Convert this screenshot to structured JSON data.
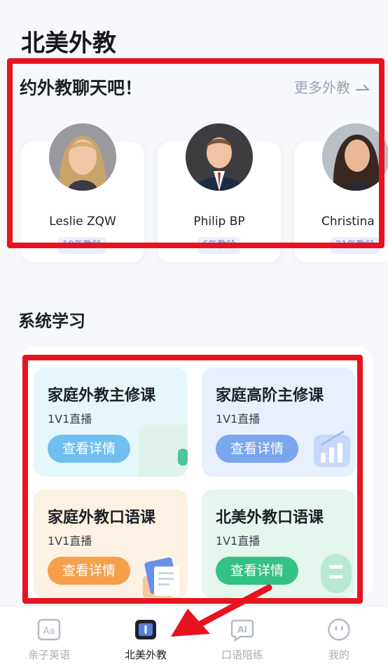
{
  "page": {
    "title": "北美外教"
  },
  "teachers": {
    "title": "约外教聊天吧！",
    "more_label": "更多外教",
    "more_icon": "arrow-right-icon",
    "items": [
      {
        "name": "Leslie ZQW",
        "experience": "10年教龄"
      },
      {
        "name": "Philip BP",
        "experience": "6年教龄"
      },
      {
        "name": "Christina",
        "experience": "21年教龄"
      }
    ]
  },
  "system_learning": {
    "title": "系统学习",
    "courses": [
      {
        "title": "家庭外教主修课",
        "subtitle": "1V1直播",
        "button": "查看详情",
        "bg": "#e6f7fb",
        "btn_color": "#6fc0f0"
      },
      {
        "title": "家庭高阶主修课",
        "subtitle": "1V1直播",
        "button": "查看详情",
        "bg": "#e8f0fd",
        "btn_color": "#7aa6ee"
      },
      {
        "title": "家庭外教口语课",
        "subtitle": "1V1直播",
        "button": "查看详情",
        "bg": "#fdf1e4",
        "btn_color": "#f6a04c"
      },
      {
        "title": "北美外教口语课",
        "subtitle": "1V1直播",
        "button": "查看详情",
        "bg": "#e5f6ee",
        "btn_color": "#35c186"
      }
    ]
  },
  "bottom_nav": {
    "items": [
      {
        "label": "亲子英语",
        "icon": "aa-book-icon",
        "active": false
      },
      {
        "label": "北美外教",
        "icon": "teacher-book-icon",
        "active": true
      },
      {
        "label": "口语陪练",
        "icon": "ai-chat-icon",
        "active": false
      },
      {
        "label": "我的",
        "icon": "face-icon",
        "active": false
      }
    ]
  },
  "colors": {
    "highlight": "#e8131f",
    "accent": "#5b86d8"
  }
}
